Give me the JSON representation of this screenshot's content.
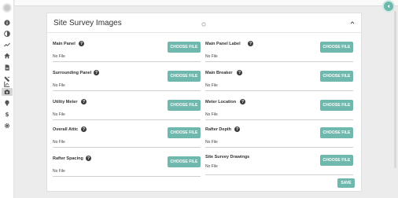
{
  "section": {
    "title": "Site Survey Images",
    "save_label": "SAVE"
  },
  "fields_left": [
    {
      "label": "Main Panel",
      "status": "No File",
      "button": "CHOOSE FILE",
      "help": true
    },
    {
      "label": "Surrounding Panel",
      "status": "No File",
      "button": "CHOOSE FILE",
      "help": true
    },
    {
      "label": "Utility Meter",
      "status": "No File",
      "button": "CHOOSE FILE",
      "help": true
    },
    {
      "label": "Overall Attic",
      "status": "No File",
      "button": "CHOOSE FILE",
      "help": true
    },
    {
      "label": "Rafter Spacing",
      "status": "No File",
      "button": "CHOOSE FILE",
      "help": true
    }
  ],
  "fields_right": [
    {
      "label": "Main Panel Label",
      "status": "No File",
      "button": "CHOOSE FILE",
      "help": true
    },
    {
      "label": "Main Breaker",
      "status": "No File",
      "button": "CHOOSE FILE",
      "help": true
    },
    {
      "label": "Meter Location",
      "status": "No File",
      "button": "CHOOSE FILE",
      "help": true
    },
    {
      "label": "Rafter Depth",
      "status": "No File",
      "button": "CHOOSE FILE",
      "help": true
    },
    {
      "label": "Site Survey Drawings",
      "status": "No File",
      "button": "CHOOSE FILE",
      "help": false
    }
  ],
  "help_glyph": "?",
  "sidebar_icons": [
    "info-icon",
    "contrast-icon",
    "trend-icon",
    "home-icon",
    "document-icon",
    "tools-icon",
    "chart-icon",
    "camera-icon",
    "lightbulb-icon",
    "dollar-icon",
    "gear-icon"
  ],
  "colors": {
    "accent": "#6fb8ad",
    "help": "#3d3d3d"
  }
}
